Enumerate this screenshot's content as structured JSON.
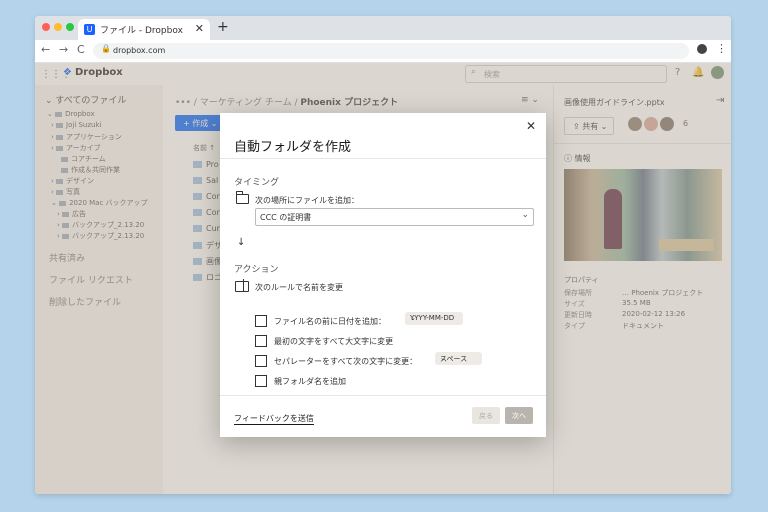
{
  "browser": {
    "tab_title": "ファイル - Dropbox",
    "tab_favicon": "U",
    "tab_close": "✕",
    "new_tab": "+",
    "nav_back": "←",
    "nav_forward": "→",
    "nav_reload": "C",
    "url": "dropbox.com",
    "more": "⋮"
  },
  "app": {
    "brand": "Dropbox",
    "search_placeholder": "検索",
    "icons": {
      "help": "?",
      "bell": "🔔"
    }
  },
  "sidebar": {
    "heading": "すべてのファイル",
    "tree": [
      "Dropbox",
      "Joji Suzuki",
      "アプリケーション",
      "アーカイブ",
      "コアチーム",
      "作成＆共同作業",
      "デザイン",
      "写真",
      "2020 Mac バックアップ",
      "広告",
      "バックアップ_2.13.20",
      "バックアップ_2.13.20"
    ],
    "links": [
      "共有済み",
      "ファイル リクエスト",
      "削除したファイル"
    ]
  },
  "main": {
    "breadcrumb_more": "•••",
    "breadcrumb_parent": "マーケティング チーム",
    "breadcrumb_current": "Phoenix プロジェクト",
    "view_toggle": "≡ ⌄",
    "create_label": "+ 作成 ⌄",
    "column_name": "名前 ↑",
    "files": [
      "Pro",
      "Sal",
      "Cor",
      "Cor",
      "Cur",
      "デザ",
      "画像",
      "ロゴ"
    ]
  },
  "panel": {
    "title": "画像使用ガイドライン.pptx",
    "collapse": "⇥",
    "share_label": "⇪ 共有 ⌄",
    "member_count": "6",
    "info_label": "ⓘ 情報",
    "properties_title": "プロパティ",
    "properties": [
      {
        "key": "保存場所",
        "value": "… Phoenix プロジェクト"
      },
      {
        "key": "サイズ",
        "value": "35.5 MB"
      },
      {
        "key": "更新日時",
        "value": "2020-02-12 13:26"
      },
      {
        "key": "タイプ",
        "value": "ドキュメント"
      }
    ]
  },
  "modal": {
    "close": "✕",
    "title": "自動フォルダを作成",
    "timing_label": "タイミング",
    "add_to_label": "次の場所にファイルを追加：",
    "select_value": "CCC の証明書",
    "select_chevron": "⌄",
    "arrow": "↓",
    "action_label": "アクション",
    "rename_label": "次のルールで名前を変更",
    "options": [
      {
        "label": "ファイル名の前に日付を追加：",
        "checked": false,
        "pill": "YYYY-MM-DD"
      },
      {
        "label": "最初の文字をすべて大文字に変更",
        "checked": false
      },
      {
        "label": "セパレーターをすべて次の文字に変更：",
        "checked": false,
        "pill": "スペース"
      },
      {
        "label": "親フォルダ名を追加",
        "checked": false
      }
    ],
    "pill_chevron": "⌄",
    "feedback_link": "フィードバックを送信",
    "back_button": "戻る",
    "next_button": "次へ"
  },
  "colors": {
    "accent": "#0061ff",
    "backdrop": "#b5d3ea",
    "overlay": "#afa594"
  }
}
